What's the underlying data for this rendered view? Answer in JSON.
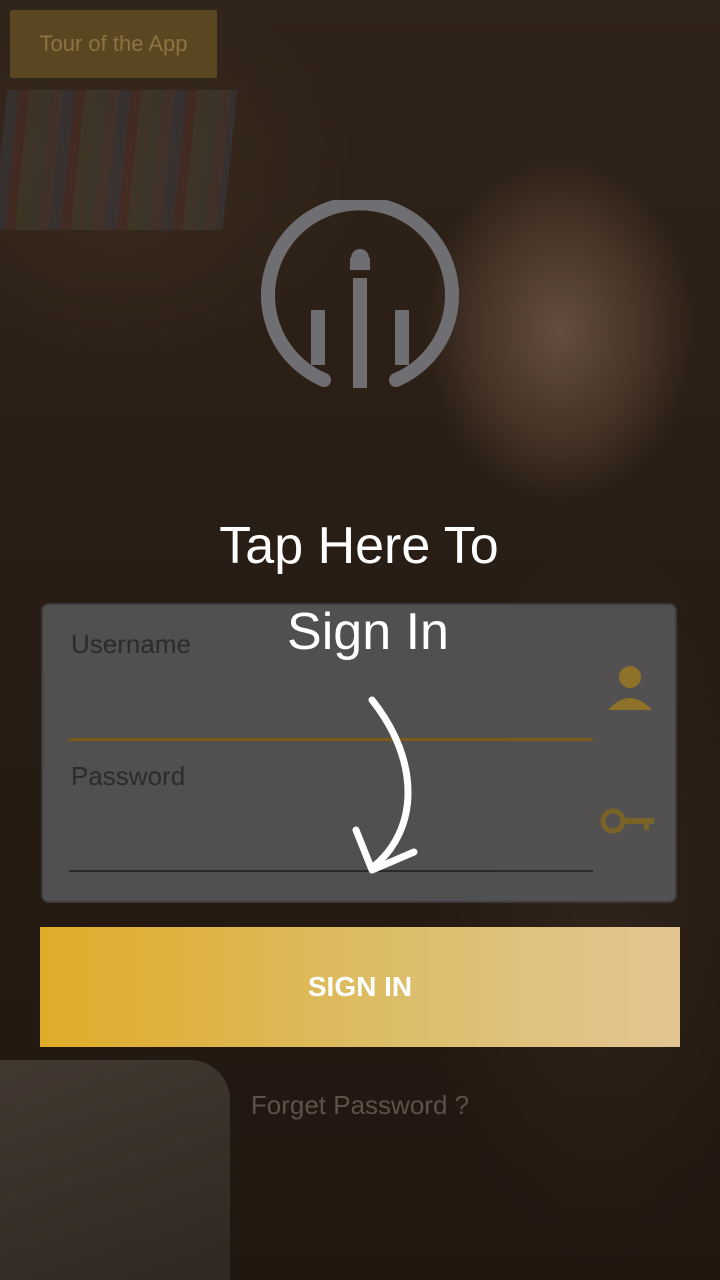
{
  "tour": {
    "label": "Tour of the App"
  },
  "hint": {
    "line1": "Tap Here To",
    "line2": "Sign In"
  },
  "form": {
    "username_label": "Username",
    "password_label": "Password",
    "username_value": "",
    "password_value": ""
  },
  "signin": {
    "label": "SIGN IN"
  },
  "forget": {
    "label": "Forget Password ?"
  },
  "icons": {
    "user": "user-icon",
    "key": "key-icon",
    "logo": "brand-logo-icon",
    "arrow": "curved-arrow-icon"
  },
  "colors": {
    "accent": "#e0ab28",
    "accent_end": "#e3c593",
    "logo": "#6f6f73",
    "card": "#58585a"
  }
}
